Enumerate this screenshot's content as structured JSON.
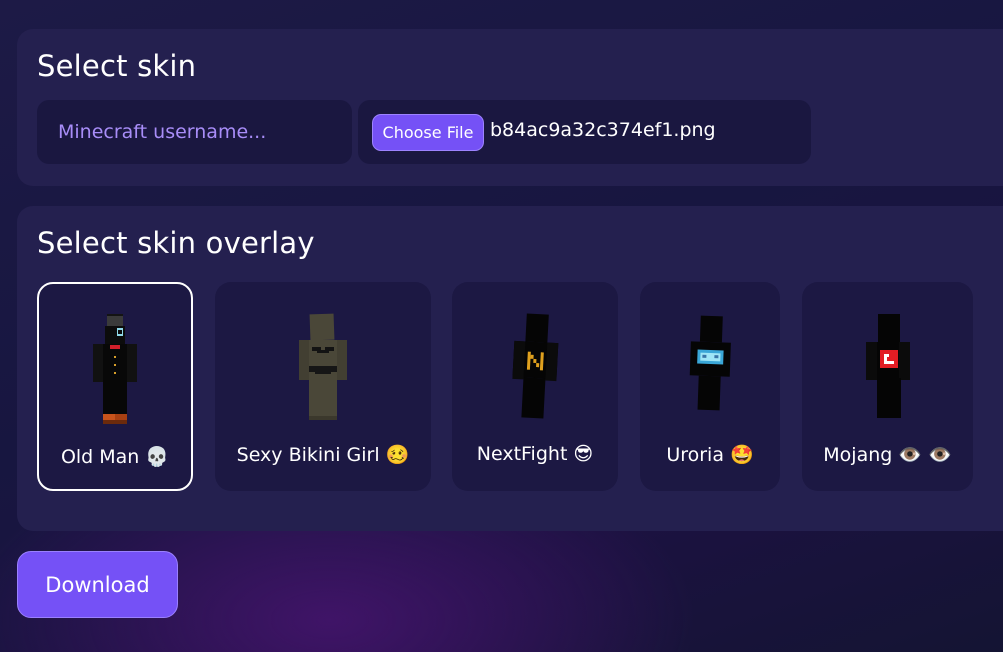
{
  "select_skin": {
    "title": "Select skin",
    "username_placeholder": "Minecraft username...",
    "username_value": "",
    "choose_file_label": "Choose File",
    "file_name": "b84ac9a32c374ef1.png"
  },
  "select_overlay": {
    "title": "Select skin overlay",
    "selected_index": 0,
    "items": [
      {
        "label": "Old Man 💀"
      },
      {
        "label": "Sexy Bikini Girl 🥴"
      },
      {
        "label": "NextFight 😎"
      },
      {
        "label": "Uroria 🤩"
      },
      {
        "label": "Mojang 👁️ 👁️"
      }
    ]
  },
  "download_label": "Download",
  "colors": {
    "accent": "#7551f6",
    "panel": "#24204f",
    "field": "#1a1740",
    "placeholder": "#a88df8"
  }
}
